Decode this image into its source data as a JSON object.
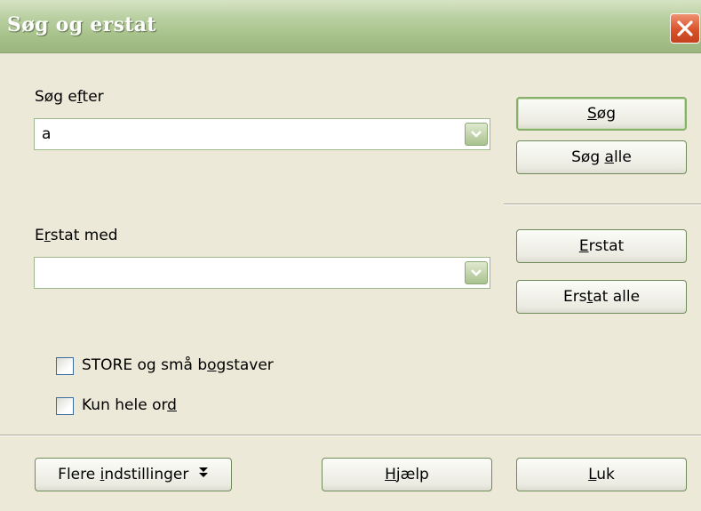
{
  "window": {
    "title": "Søg og erstat"
  },
  "search": {
    "label_before": "Søg e",
    "label_key": "f",
    "label_after": "ter",
    "value": "a"
  },
  "replace": {
    "label_before": "E",
    "label_key": "r",
    "label_after": "stat med",
    "value": ""
  },
  "buttons": {
    "search": {
      "before": "",
      "key": "S",
      "after": "øg"
    },
    "search_all": {
      "before": "Søg ",
      "key": "a",
      "after": "lle"
    },
    "replace": {
      "before": "",
      "key": "E",
      "after": "rstat"
    },
    "replace_all": {
      "before": "Ers",
      "key": "t",
      "after": "at alle"
    },
    "more_options": {
      "before": "Flere ",
      "key": "i",
      "after": "ndstillinger"
    },
    "help": {
      "before": "",
      "key": "H",
      "after": "jælp"
    },
    "close": {
      "before": "",
      "key": "L",
      "after": "uk"
    }
  },
  "options": {
    "match_case": {
      "before": "STORE og små b",
      "key": "o",
      "after": "gstaver",
      "checked": false
    },
    "whole_words": {
      "before": "Kun hele or",
      "key": "d",
      "after": "",
      "checked": false
    }
  },
  "icons": {
    "close": "close-x-icon",
    "dropdown": "chevron-down-icon",
    "expand": "double-chevron-down-icon"
  },
  "colors": {
    "titlebar": "#a7c18a",
    "close_button": "#d8532b",
    "dialog_bg": "#ece9d8",
    "border_accent": "#88b06b"
  }
}
